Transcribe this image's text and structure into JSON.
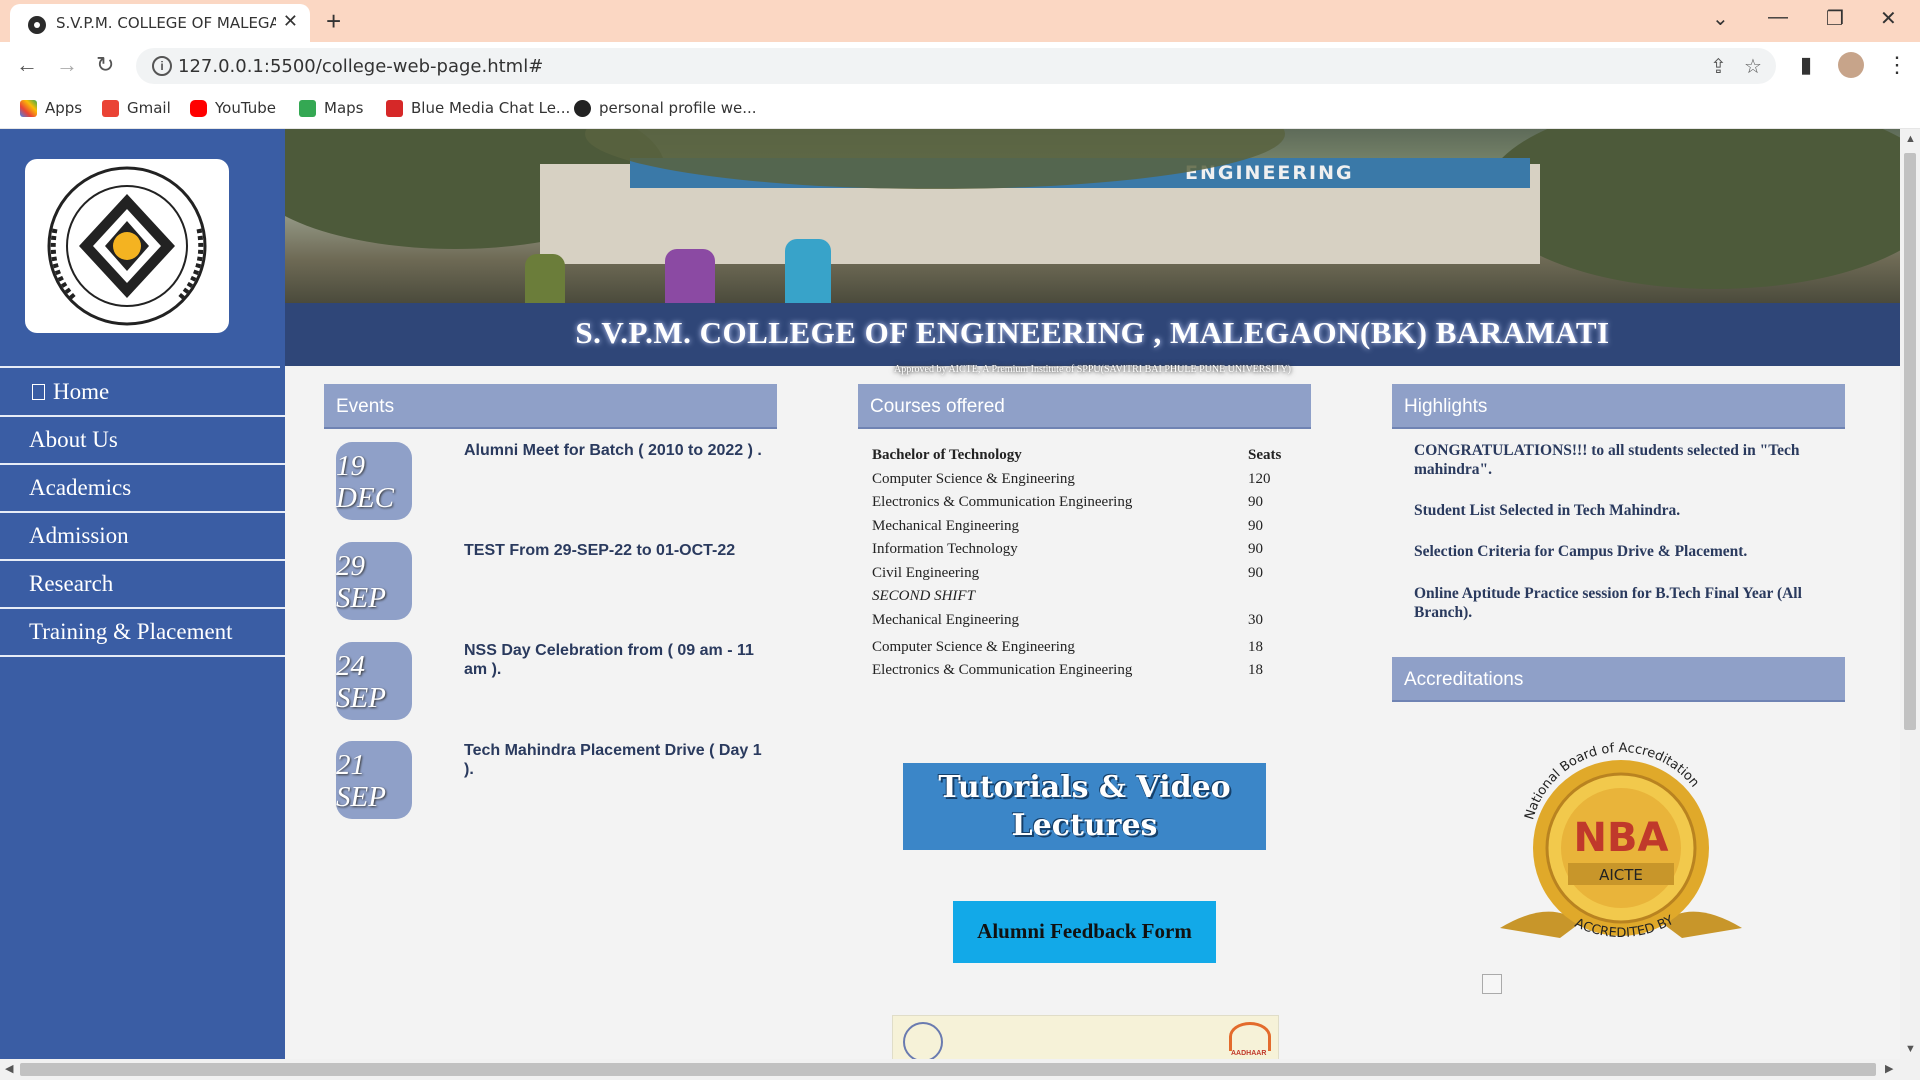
{
  "browser": {
    "tab_title": "S.V.P.M. COLLEGE OF MALEGAON",
    "tab_close": "✕",
    "new_tab": "+",
    "url": "127.0.0.1:5500/college-web-page.html#",
    "bookmarks": [
      {
        "label": "Apps",
        "icon": "apps-grid-icon",
        "color": "#4285f4"
      },
      {
        "label": "Gmail",
        "icon": "gmail-icon",
        "color": "#ea4335"
      },
      {
        "label": "YouTube",
        "icon": "youtube-icon",
        "color": "#ff0000"
      },
      {
        "label": "Maps",
        "icon": "maps-icon",
        "color": "#34a853"
      },
      {
        "label": "Blue Media Chat Le...",
        "icon": "blue-media-icon",
        "color": "#d62828"
      },
      {
        "label": "personal profile we...",
        "icon": "globe-icon",
        "color": "#222222"
      }
    ]
  },
  "sidebar": {
    "logo_caption": "शिवनगर विद्या प्रसारक मंडळ",
    "logo_motto": "॥ योगः कर्मसु कौशलम् ॥",
    "menu": [
      {
        "label": "Home"
      },
      {
        "label": "About Us"
      },
      {
        "label": "Academics"
      },
      {
        "label": "Admission"
      },
      {
        "label": "Research"
      },
      {
        "label": "Training & Placement"
      }
    ]
  },
  "header": {
    "banner_sign": "ENGINEERING",
    "college_title": "S.V.P.M. COLLEGE OF ENGINEERING , MALEGAON(BK) BARAMATI",
    "subtitle": "Approved by AICTE, A Premium Institute of SPPU(SAVITRI BAI PHULE PUNE UNIVERSITY)"
  },
  "events": {
    "heading": "Events",
    "items": [
      {
        "day": "19",
        "month": "DEC",
        "text": "Alumni Meet for Batch ( 2010 to 2022 ) ."
      },
      {
        "day": "29",
        "month": "SEP",
        "text": "TEST From 29-SEP-22 to 01-OCT-22"
      },
      {
        "day": "24",
        "month": "SEP",
        "text": "NSS Day Celebration from ( 09 am - 11 am )."
      },
      {
        "day": "21",
        "month": "SEP",
        "text": "Tech Mahindra Placement Drive ( Day 1 )."
      }
    ]
  },
  "courses": {
    "heading": "Courses offered",
    "col_program": "Bachelor of Technology",
    "col_seats": "Seats",
    "rows": [
      {
        "name": "Computer Science & Engineering",
        "seats": "120"
      },
      {
        "name": "Electronics & Communication Engineering",
        "seats": "90"
      },
      {
        "name": "Mechanical Engineering",
        "seats": "90"
      },
      {
        "name": "Information Technology",
        "seats": "90"
      },
      {
        "name": "Civil Engineering",
        "seats": "90"
      }
    ],
    "second_shift_label": "SECOND SHIFT",
    "second_shift_rows": [
      {
        "name": "Mechanical Engineering",
        "seats": "30"
      },
      {
        "name": "Computer Science & Engineering",
        "seats": "18"
      },
      {
        "name": "Electronics & Communication Engineering",
        "seats": "18"
      }
    ],
    "tutorials_button": "Tutorials & Video Lectures",
    "alumni_button": "Alumni Feedback Form",
    "aadhaar_label": "AADHAAR"
  },
  "highlights": {
    "heading": "Highlights",
    "items": [
      "CONGRATULATIONS!!! to all students selected in \"Tech mahindra\".",
      "Student List Selected in Tech Mahindra.",
      "Selection Criteria for Campus Drive & Placement.",
      "Online Aptitude Practice session for B.Tech Final Year (All Branch)."
    ]
  },
  "accreditations": {
    "heading": "Accreditations",
    "badge_arc": "National Board of Accreditation",
    "badge_main": "NBA",
    "badge_sub": "AICTE",
    "badge_ribbon": "ACCREDITED BY"
  },
  "colors": {
    "sidebar": "#3a5da4",
    "panel_header": "#8fa0c8",
    "title_bar": "#2f4678",
    "tutorials_button": "#3b86c8",
    "alumni_button": "#12a9e8"
  }
}
